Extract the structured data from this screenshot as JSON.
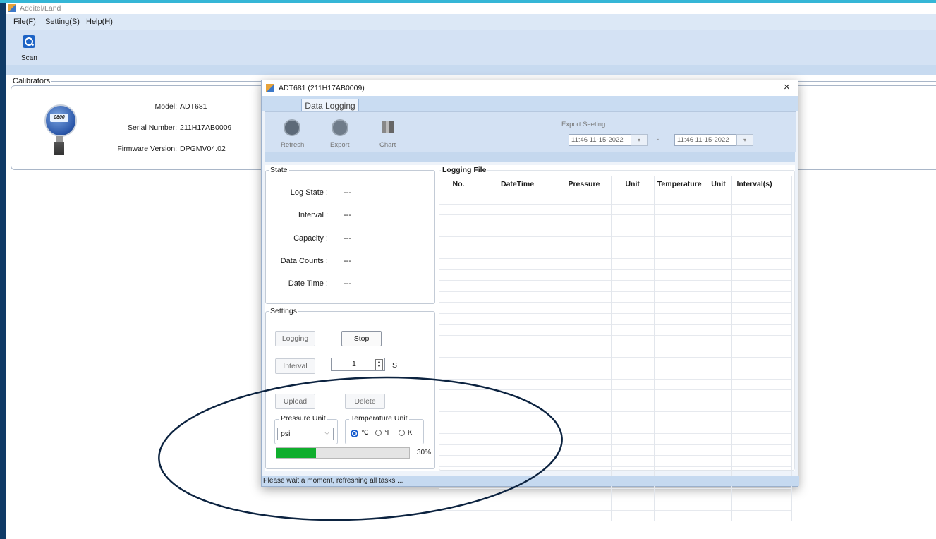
{
  "app": {
    "title": "Additel/Land"
  },
  "menu": {
    "items": [
      "File(F)",
      "Setting(S)",
      "Help(H)"
    ]
  },
  "toolbar": {
    "scan_label": "Scan"
  },
  "calibrators": {
    "section_label": "Calibrators",
    "model_label": "Model:",
    "model": "ADT681",
    "serial_label": "Serial Number:",
    "serial": "211H17AB0009",
    "firmware_label": "Firmware Version:",
    "firmware": "DPGMV04.02",
    "device_display": "0800"
  },
  "dialog": {
    "title": "ADT681 (211H17AB0009)",
    "close_glyph": "×",
    "tab": "Data Logging",
    "tools": [
      "Refresh",
      "Export",
      "Chart"
    ],
    "export_setting_label": "Export Seeting",
    "start_time": "11:46 11-15-2022",
    "end_time": "11:46 11-15-2022",
    "range_sep": "-",
    "state": {
      "title": "State",
      "rows": [
        {
          "label": "Log State :",
          "value": "---"
        },
        {
          "label": "Interval :",
          "value": "---"
        },
        {
          "label": "Capacity :",
          "value": "---"
        },
        {
          "label": "Data Counts :",
          "value": "---"
        },
        {
          "label": "Date Time :",
          "value": "---"
        }
      ]
    },
    "settings": {
      "title": "Settings",
      "logging": "Logging",
      "stop": "Stop",
      "interval": "Interval",
      "interval_value": "1",
      "interval_unit": "S",
      "upload": "Upload",
      "delete": "Delete",
      "pressure_unit_title": "Pressure Unit",
      "pressure_unit": "psi",
      "temperature_unit_title": "Temperature Unit",
      "temp_units": [
        "℃",
        "℉",
        "K"
      ],
      "temp_selected": "℃",
      "progress": 0.3,
      "progress_text": "30%"
    },
    "logging_file": {
      "title": "Logging File",
      "columns": [
        "No.",
        "DateTime",
        "Pressure",
        "Unit",
        "Temperature",
        "Unit",
        "Interval(s)"
      ]
    },
    "status": "Please wait a moment, refreshing all tasks ..."
  }
}
